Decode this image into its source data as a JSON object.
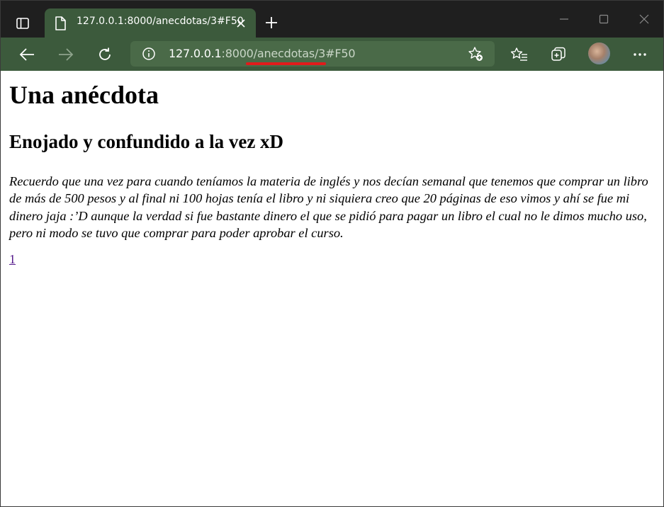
{
  "browser": {
    "tab": {
      "title": "127.0.0.1:8000/anecdotas/3#F50"
    },
    "address_bar": {
      "url_host": "127.0.0.1",
      "url_rest": ":8000/anecdotas/3#F50"
    },
    "icons": {
      "sidebar_toggle": "sidebar-toggle-icon",
      "favicon": "page-icon",
      "tab_close": "close-icon",
      "new_tab": "plus-icon",
      "minimize": "minimize-icon",
      "maximize": "maximize-icon",
      "window_close": "close-icon",
      "back": "arrow-left-icon",
      "forward": "arrow-right-icon",
      "refresh": "refresh-icon",
      "info": "info-icon",
      "add_favorite": "star-plus-icon",
      "favorites": "favorites-icon",
      "collections": "collections-icon",
      "profile": "avatar",
      "menu": "more-icon"
    },
    "colors": {
      "frame": "#1f1f1f",
      "theme_green": "#3c5a3c",
      "address_bg": "#4a6a48",
      "highlight_underline": "#e11b1b",
      "visited_link": "#551a8b"
    }
  },
  "page": {
    "heading": "Una anécdota",
    "subheading": "Enojado y confundido a la vez xD",
    "body": "Recuerdo que una vez para cuando teníamos la materia de inglés y nos decían semanal que tenemos que comprar un libro de más de 500 pesos y al final ni 100 hojas tenía el libro y ni siquiera creo que 20 páginas de eso vimos y ahí se fue mi dinero jaja :’D aunque la verdad si fue bastante dinero el que se pidió para pagar un libro el cual no le dimos mucho uso, pero ni modo se tuvo que comprar para poder aprobar el curso.",
    "pager_link": "1"
  }
}
